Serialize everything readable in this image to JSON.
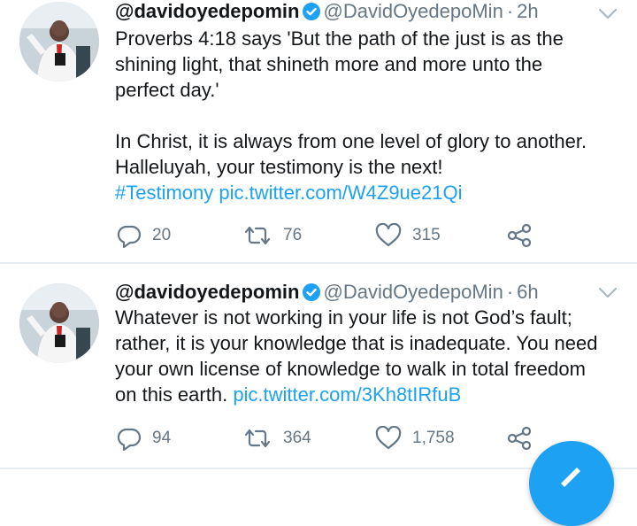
{
  "tweets": [
    {
      "display_name": "@davidoyedepomin",
      "handle": "@DavidOyedepoMin",
      "time": "2h",
      "text_lines": [
        "Proverbs 4:18 says 'But the path of the just is as the",
        "shining light, that shineth more and more unto the",
        "perfect day.'",
        "",
        "In Christ, it is always from one level of glory to another.",
        "Halleluyah, your testimony is the next!"
      ],
      "hashtag": "#Testimony",
      "pic_link": "pic.twitter.com/W4Z9ue21Qi",
      "replies": "20",
      "retweets": "76",
      "likes": "315"
    },
    {
      "display_name": "@davidoyedepomin",
      "handle": "@DavidOyedepoMin",
      "time": "6h",
      "text_lines": [
        "Whatever is not working in your life is not God’s fault;",
        "rather, it is your knowledge that is inadequate. You need",
        "your own license of knowledge to walk in total freedom",
        "on this earth."
      ],
      "pic_link": "pic.twitter.com/3Kh8tIRfuB",
      "replies": "94",
      "retweets": "364",
      "likes": "1,758"
    }
  ],
  "colors": {
    "link": "#1da1f2",
    "secondary_text": "#657786",
    "divider": "#e6ecf0",
    "verified_badge": "#1da1f2"
  },
  "icons": {
    "verified": "verified-badge-icon",
    "chevron": "chevron-down-icon",
    "reply": "reply-icon",
    "retweet": "retweet-icon",
    "like": "heart-icon",
    "share": "share-icon",
    "compose": "compose-tweet-icon"
  }
}
